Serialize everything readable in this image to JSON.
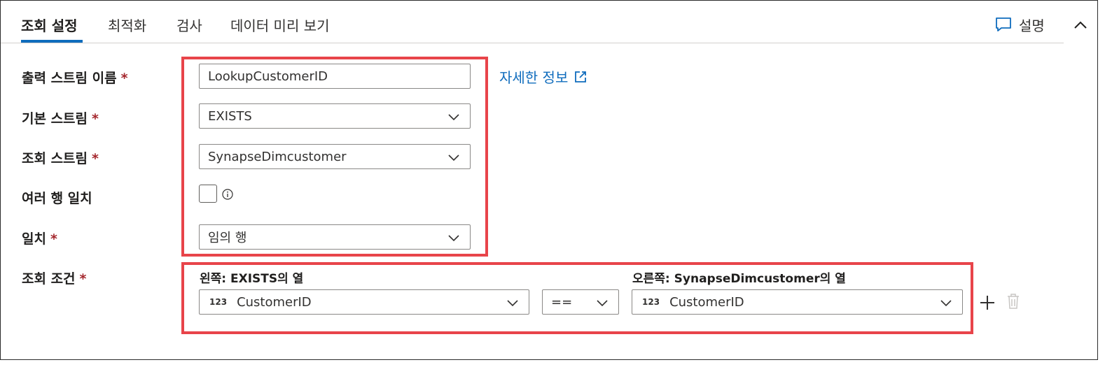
{
  "tabs": [
    {
      "label": "조회 설정"
    },
    {
      "label": "최적화"
    },
    {
      "label": "검사"
    },
    {
      "label": "데이터 미리 보기"
    }
  ],
  "header": {
    "explain_label": "설명"
  },
  "form": {
    "output_stream": {
      "label": "출력 스트림 이름",
      "required_mark": "*",
      "value": "LookupCustomerID"
    },
    "learn_more": "자세한 정보",
    "primary_stream": {
      "label": "기본 스트림",
      "required_mark": "*",
      "value": "EXISTS"
    },
    "lookup_stream": {
      "label": "조회 스트림",
      "required_mark": "*",
      "value": "SynapseDimcustomer"
    },
    "match_multiple": {
      "label": "여러 행 일치",
      "checked": false
    },
    "match": {
      "label": "일치",
      "required_mark": "*",
      "value": "임의 행"
    },
    "lookup_conditions": {
      "label": "조회 조건",
      "required_mark": "*",
      "left_header": "왼쪽: EXISTS의 열",
      "right_header": "오른쪽: SynapseDimcustomer의 열",
      "left_type": "123",
      "left_value": "CustomerID",
      "operator": "==",
      "right_type": "123",
      "right_value": "CustomerID"
    }
  },
  "colors": {
    "accent": "#0f6cbd",
    "highlight_border": "#e8444a",
    "required": "#a4262c"
  },
  "icons": [
    "comment-icon",
    "chevron-up-icon",
    "external-link-icon",
    "chevron-down-icon",
    "info-icon",
    "plus-icon",
    "trash-icon"
  ]
}
